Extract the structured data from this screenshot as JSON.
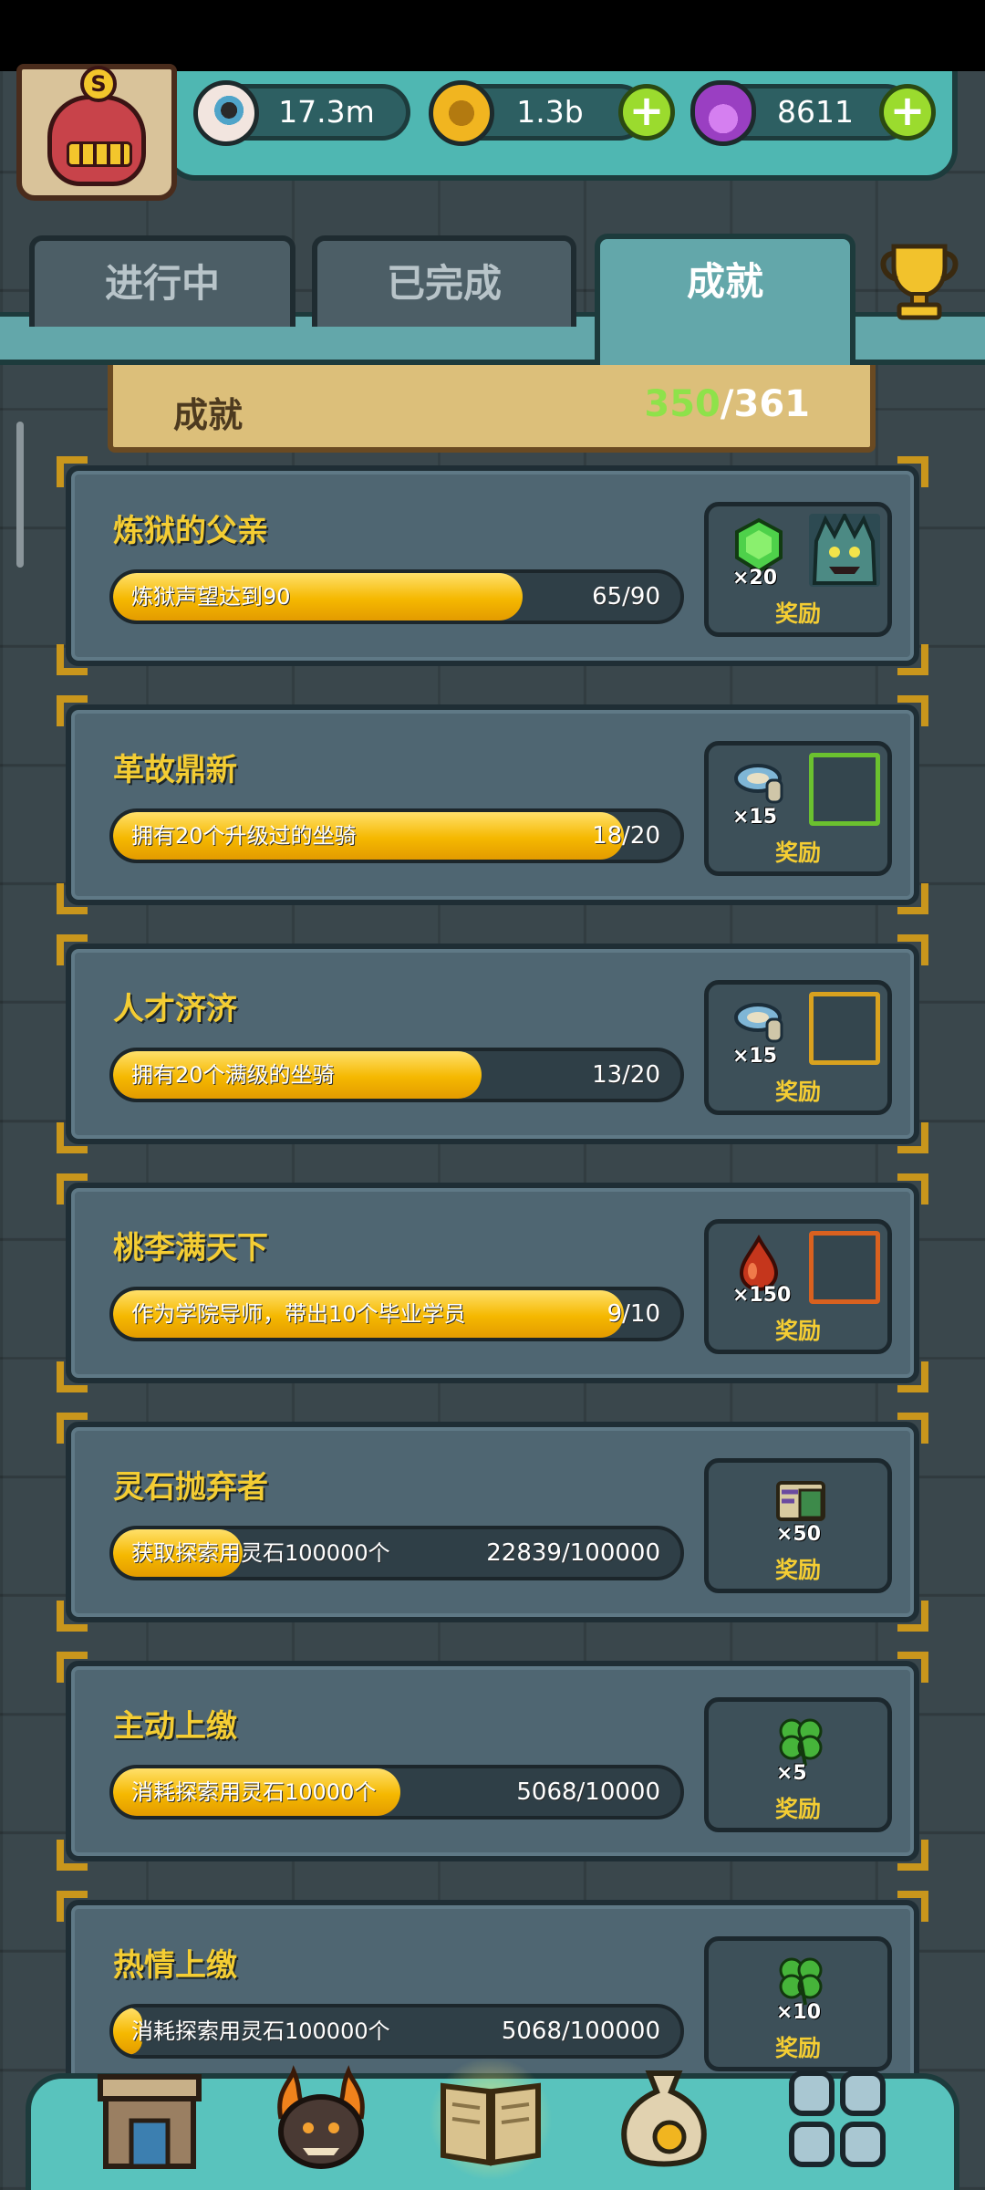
{
  "resources": {
    "eyes": "17.3m",
    "coins": "1.3b",
    "potions": "8611"
  },
  "tabs": [
    {
      "label": "进行中",
      "active": false
    },
    {
      "label": "已完成",
      "active": false
    },
    {
      "label": "成就",
      "active": true
    }
  ],
  "header": {
    "title": "成就",
    "current": "350",
    "separator": "/",
    "total": "361"
  },
  "reward_label": "奖励",
  "achievements": [
    {
      "title": "炼狱的父亲",
      "desc": "炼狱声望达到90",
      "progress_text": "65/90",
      "progress": 0.7222,
      "reward_icon": "green-gem-icon",
      "reward_qty": "×20",
      "frame": "monster-portrait-frame"
    },
    {
      "title": "革故鼎新",
      "desc": "拥有20个升级过的坐骑",
      "progress_text": "18/20",
      "progress": 0.9,
      "reward_icon": "mount-gear-icon",
      "reward_qty": "×15",
      "frame": "green-frame"
    },
    {
      "title": "人才济济",
      "desc": "拥有20个满级的坐骑",
      "progress_text": "13/20",
      "progress": 0.65,
      "reward_icon": "mount-gear-icon",
      "reward_qty": "×15",
      "frame": "gold-frame"
    },
    {
      "title": "桃李满天下",
      "desc": "作为学院导师，带出10个毕业学员",
      "progress_text": "9/10",
      "progress": 0.9,
      "reward_icon": "blood-drop-icon",
      "reward_qty": "×150",
      "frame": "orange-frame"
    },
    {
      "title": "灵石抛弃者",
      "desc": "获取探索用灵石100000个",
      "progress_text": "22839/100000",
      "progress": 0.2284,
      "reward_icon": "map-scroll-icon",
      "reward_qty": "×50",
      "frame": ""
    },
    {
      "title": "主动上缴",
      "desc": "消耗探索用灵石10000个",
      "progress_text": "5068/10000",
      "progress": 0.5068,
      "reward_icon": "clover-icon",
      "reward_qty": "×5",
      "frame": ""
    },
    {
      "title": "热情上缴",
      "desc": "消耗探索用灵石100000个",
      "progress_text": "5068/100000",
      "progress": 0.0507,
      "reward_icon": "clover-icon",
      "reward_qty": "×10",
      "frame": ""
    }
  ],
  "bottom_nav": [
    {
      "name": "shop-building-icon",
      "active": false
    },
    {
      "name": "flame-beast-icon",
      "active": false
    },
    {
      "name": "open-book-icon",
      "active": true
    },
    {
      "name": "money-bag-icon",
      "active": false
    },
    {
      "name": "grid-menu-icon",
      "active": false
    }
  ],
  "colors": {
    "accent_yellow": "#f4cd33",
    "progress_fill": "#f5b800",
    "count_green": "#8ee24a",
    "tab_active": "#63a7aa",
    "plus_green": "#9bdb2e"
  }
}
